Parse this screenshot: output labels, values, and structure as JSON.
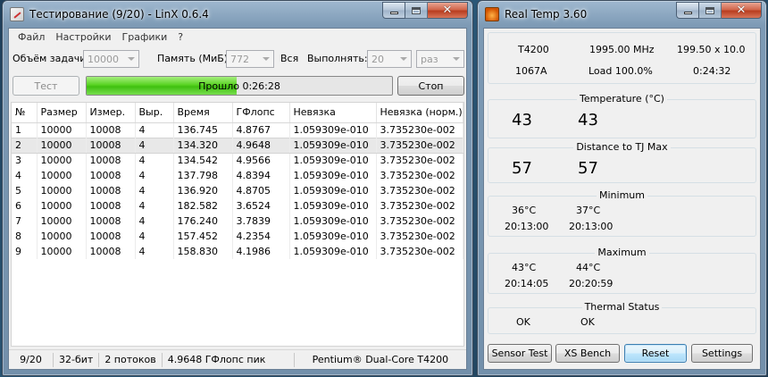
{
  "linx": {
    "title": "Тестирование (9/20) - LinX 0.6.4",
    "menu": [
      "Файл",
      "Настройки",
      "Графики",
      "?"
    ],
    "params": {
      "task_label": "Объём задачи:",
      "task_value": "10000",
      "memory_label": "Память (МиБ):",
      "memory_value": "772",
      "all_label": "Вся",
      "run_label": "Выполнять:",
      "run_value": "20",
      "run_unit": "раз"
    },
    "test_button": "Тест",
    "stop_button": "Стоп",
    "progress": {
      "fraction": 0.49,
      "text": "Прошло 0:26:28"
    },
    "table": {
      "columns": [
        "№",
        "Размер",
        "Измер.",
        "Выр.",
        "Время",
        "ГФлопс",
        "Невязка",
        "Невязка (норм.)"
      ],
      "selected_row": 1,
      "rows": [
        [
          "1",
          "10000",
          "10008",
          "4",
          "136.745",
          "4.8767",
          "1.059309e-010",
          "3.735230e-002"
        ],
        [
          "2",
          "10000",
          "10008",
          "4",
          "134.320",
          "4.9648",
          "1.059309e-010",
          "3.735230e-002"
        ],
        [
          "3",
          "10000",
          "10008",
          "4",
          "134.542",
          "4.9566",
          "1.059309e-010",
          "3.735230e-002"
        ],
        [
          "4",
          "10000",
          "10008",
          "4",
          "137.798",
          "4.8394",
          "1.059309e-010",
          "3.735230e-002"
        ],
        [
          "5",
          "10000",
          "10008",
          "4",
          "136.920",
          "4.8705",
          "1.059309e-010",
          "3.735230e-002"
        ],
        [
          "6",
          "10000",
          "10008",
          "4",
          "182.582",
          "3.6524",
          "1.059309e-010",
          "3.735230e-002"
        ],
        [
          "7",
          "10000",
          "10008",
          "4",
          "176.240",
          "3.7839",
          "1.059309e-010",
          "3.735230e-002"
        ],
        [
          "8",
          "10000",
          "10008",
          "4",
          "157.452",
          "4.2354",
          "1.059309e-010",
          "3.735230e-002"
        ],
        [
          "9",
          "10000",
          "10008",
          "4",
          "158.830",
          "4.1986",
          "1.059309e-010",
          "3.735230e-002"
        ]
      ]
    },
    "status": {
      "progress": "9/20",
      "bits": "32-бит",
      "threads": "2 потоков",
      "peak": "4.9648 ГФлопс пик",
      "cpu": "Pentium® Dual-Core T4200"
    }
  },
  "realtemp": {
    "title": "Real Temp 3.60",
    "info": {
      "cpu": "T4200",
      "freq": "1995.00 MHz",
      "multiplier": "199.50 x 10.0",
      "stepping": "1067A",
      "load": "Load 100.0%",
      "time": "0:24:32"
    },
    "temperature": {
      "title": "Temperature (°C)",
      "core0": "43",
      "core1": "43"
    },
    "distance": {
      "title": "Distance to TJ Max",
      "core0": "57",
      "core1": "57"
    },
    "minimum": {
      "title": "Minimum",
      "core0": "36°C",
      "core1": "37°C",
      "time0": "20:13:00",
      "time1": "20:13:00"
    },
    "maximum": {
      "title": "Maximum",
      "core0": "43°C",
      "core1": "44°C",
      "time0": "20:14:05",
      "time1": "20:20:59"
    },
    "thermal": {
      "title": "Thermal Status",
      "core0": "OK",
      "core1": "OK"
    },
    "buttons": {
      "sensor_test": "Sensor Test",
      "xs_bench": "XS Bench",
      "reset": "Reset",
      "settings": "Settings"
    }
  }
}
